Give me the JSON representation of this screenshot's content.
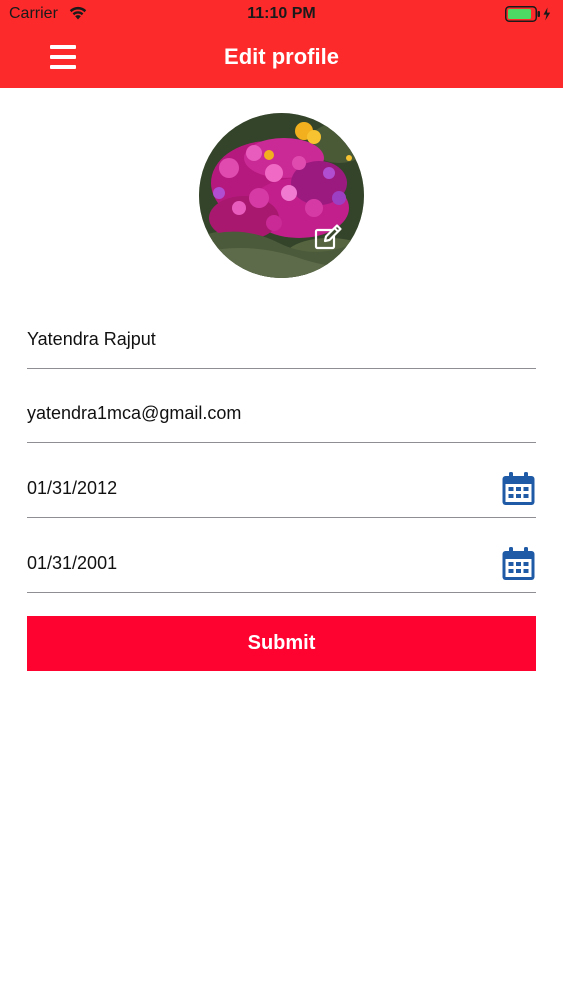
{
  "status_bar": {
    "carrier": "Carrier",
    "time": "11:10 PM",
    "battery_color": "#4cd964"
  },
  "nav_bar": {
    "title": "Edit profile",
    "menu_icon": "hamburger-menu-icon",
    "background_color": "#fd2a2b"
  },
  "profile": {
    "avatar_icon": "flower-photo",
    "edit_icon": "edit-pencil-icon"
  },
  "form": {
    "name": "Yatendra Rajput",
    "email": "yatendra1mca@gmail.com",
    "date_1": "01/31/2012",
    "date_2": "01/31/2001",
    "calendar_icon": "calendar-icon",
    "calendar_color": "#1f5aa6"
  },
  "submit": {
    "label": "Submit",
    "color": "#fe0230"
  }
}
